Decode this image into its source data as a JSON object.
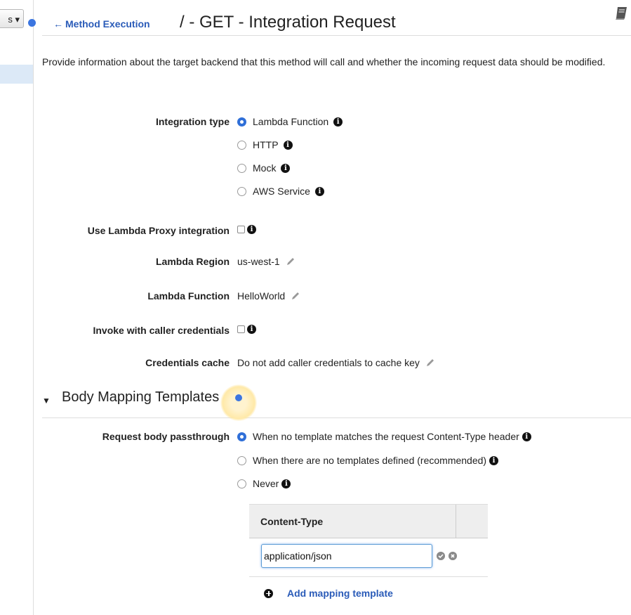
{
  "sidebar": {
    "actions_label": "s ▾"
  },
  "header": {
    "back_arrow": "←",
    "back_link": "Method Execution",
    "title": "/ - GET - Integration Request"
  },
  "description": "Provide information about the target backend that this method will call and whether the incoming request data should be modified.",
  "integration_type": {
    "label": "Integration type",
    "options": [
      {
        "label": "Lambda Function",
        "checked": true
      },
      {
        "label": "HTTP",
        "checked": false
      },
      {
        "label": "Mock",
        "checked": false
      },
      {
        "label": "AWS Service",
        "checked": false
      }
    ]
  },
  "lambda_proxy": {
    "label": "Use Lambda Proxy integration",
    "checked": false
  },
  "lambda_region": {
    "label": "Lambda Region",
    "value": "us-west-1"
  },
  "lambda_function": {
    "label": "Lambda Function",
    "value": "HelloWorld"
  },
  "caller_credentials": {
    "label": "Invoke with caller credentials",
    "checked": false
  },
  "credentials_cache": {
    "label": "Credentials cache",
    "value": "Do not add caller credentials to cache key"
  },
  "body_mapping": {
    "title": "Body Mapping Templates",
    "passthrough_label": "Request body passthrough",
    "options": [
      {
        "label": "When no template matches the request Content-Type header",
        "checked": true
      },
      {
        "label": "When there are no templates defined (recommended)",
        "checked": false
      },
      {
        "label": "Never",
        "checked": false
      }
    ],
    "table_header": "Content-Type",
    "content_type_value": "application/json",
    "add_label": "Add mapping template"
  },
  "info_glyph": "i",
  "colors": {
    "accent": "#2f6fd8",
    "link": "#2a5bb8"
  }
}
